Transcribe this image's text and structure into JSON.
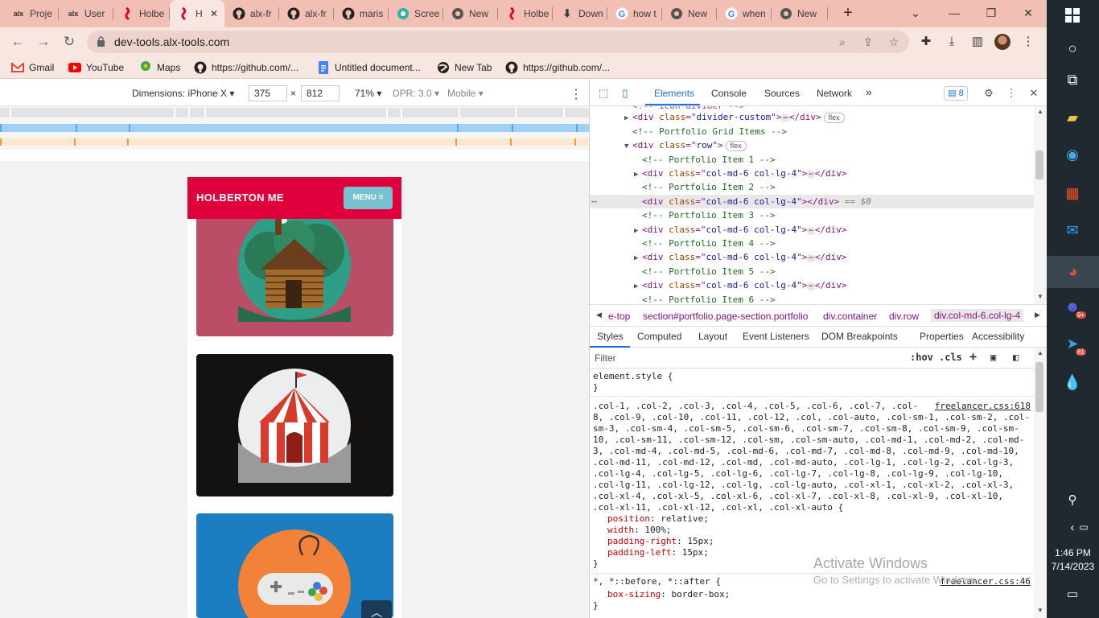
{
  "browser": {
    "tabs": [
      {
        "title": "Proje",
        "icon": "alx-logo-icon",
        "icon_text": "alx"
      },
      {
        "title": "User",
        "icon": "alx-logo-icon",
        "icon_text": "alx"
      },
      {
        "title": "Holbe",
        "icon": "holberton-logo-icon",
        "icon_text": ""
      },
      {
        "title": "H",
        "icon": "holberton-logo-icon",
        "icon_text": "",
        "active": true
      },
      {
        "title": "alx-fr",
        "icon": "github-icon",
        "icon_text": ""
      },
      {
        "title": "alx-fr",
        "icon": "github-icon",
        "icon_text": ""
      },
      {
        "title": "maris",
        "icon": "github-icon",
        "icon_text": ""
      },
      {
        "title": "Scree",
        "icon": "screen-app-icon",
        "icon_text": ""
      },
      {
        "title": "New",
        "icon": "chrome-icon",
        "icon_text": ""
      },
      {
        "title": "Holbe",
        "icon": "holberton-logo-icon",
        "icon_text": ""
      },
      {
        "title": "Down",
        "icon": "download-icon",
        "icon_text": "⬇"
      },
      {
        "title": "how t",
        "icon": "google-icon",
        "icon_text": "G"
      },
      {
        "title": "New",
        "icon": "chrome-icon",
        "icon_text": ""
      },
      {
        "title": "when",
        "icon": "google-icon",
        "icon_text": "G"
      },
      {
        "title": "New",
        "icon": "chrome-icon",
        "icon_text": ""
      }
    ],
    "new_tab_label": "+",
    "url": "dev-tools.alx-tools.com",
    "bookmarks": [
      {
        "label": "Gmail",
        "icon": "gmail-icon"
      },
      {
        "label": "YouTube",
        "icon": "youtube-icon"
      },
      {
        "label": "Maps",
        "icon": "maps-icon"
      },
      {
        "label": "https://github.com/...",
        "icon": "github-icon"
      },
      {
        "label": "Untitled document...",
        "icon": "docs-icon"
      },
      {
        "label": "New Tab",
        "icon": "globe-icon"
      },
      {
        "label": "https://github.com/...",
        "icon": "github-icon"
      }
    ]
  },
  "device_toolbar": {
    "dimensions_label": "Dimensions: iPhone X",
    "width_value": "375",
    "times": "×",
    "height_value": "812",
    "zoom": "71%",
    "dpr": "DPR: 3.0",
    "mode": "Mobile"
  },
  "page": {
    "brand": "HOLBERTON ME",
    "menu_label": "MENU",
    "cards": [
      {
        "name": "cabin",
        "bg": "#b94e66"
      },
      {
        "name": "circus-tent",
        "bg": "#141111"
      },
      {
        "name": "game-controller",
        "bg": "#1b7ec0"
      }
    ],
    "accent": "#e0003c"
  },
  "devtools": {
    "tabs": [
      "Elements",
      "Console",
      "Sources",
      "Network"
    ],
    "more": "»",
    "issues_count": "8",
    "dom_lines": [
      {
        "indent": 0,
        "arrow": "",
        "parts": [
          [
            "tg",
            "<!-- icon divider -->"
          ]
        ],
        "truncated_top": true
      },
      {
        "indent": 0,
        "arrow": "▶",
        "parts": [
          [
            "tg",
            "<div "
          ],
          [
            "at",
            "class"
          ],
          [
            "tg",
            "=\""
          ],
          [
            "av",
            "divider-custom"
          ],
          [
            "tg",
            "\">"
          ],
          [
            "dots",
            "⋯"
          ],
          [
            "tg",
            "</div>"
          ],
          [
            "pill",
            "flex"
          ]
        ]
      },
      {
        "indent": 0,
        "arrow": "",
        "parts": [
          [
            "cm",
            "<!-- Portfolio Grid Items -->"
          ]
        ]
      },
      {
        "indent": 0,
        "arrow": "▼",
        "parts": [
          [
            "tg",
            "<div "
          ],
          [
            "at",
            "class"
          ],
          [
            "tg",
            "=\""
          ],
          [
            "av",
            "row"
          ],
          [
            "tg",
            "\">"
          ],
          [
            "pill",
            "flex"
          ]
        ]
      },
      {
        "indent": 1,
        "arrow": "",
        "parts": [
          [
            "cm",
            "<!-- Portfolio Item 1 -->"
          ]
        ]
      },
      {
        "indent": 1,
        "arrow": "▶",
        "parts": [
          [
            "tg",
            "<div "
          ],
          [
            "at",
            "class"
          ],
          [
            "tg",
            "=\""
          ],
          [
            "av",
            "col-md-6 col-lg-4"
          ],
          [
            "tg",
            "\">"
          ],
          [
            "dots",
            "⋯"
          ],
          [
            "tg",
            "</div>"
          ]
        ]
      },
      {
        "indent": 1,
        "arrow": "",
        "parts": [
          [
            "cm",
            "<!-- Portfolio Item 2 -->"
          ]
        ]
      },
      {
        "indent": 1,
        "arrow": "",
        "selected": true,
        "parts": [
          [
            "tg",
            "<div "
          ],
          [
            "at",
            "class"
          ],
          [
            "tg",
            "=\""
          ],
          [
            "av",
            "col-md-6 col-lg-4"
          ],
          [
            "tg",
            "\"></div>"
          ],
          [
            "eq",
            " == $0"
          ]
        ]
      },
      {
        "indent": 1,
        "arrow": "",
        "parts": [
          [
            "cm",
            "<!-- Portfolio Item 3 -->"
          ]
        ]
      },
      {
        "indent": 1,
        "arrow": "▶",
        "parts": [
          [
            "tg",
            "<div "
          ],
          [
            "at",
            "class"
          ],
          [
            "tg",
            "=\""
          ],
          [
            "av",
            "col-md-6 col-lg-4"
          ],
          [
            "tg",
            "\">"
          ],
          [
            "dots",
            "⋯"
          ],
          [
            "tg",
            "</div>"
          ]
        ]
      },
      {
        "indent": 1,
        "arrow": "",
        "parts": [
          [
            "cm",
            "<!-- Portfolio Item 4 -->"
          ]
        ]
      },
      {
        "indent": 1,
        "arrow": "▶",
        "parts": [
          [
            "tg",
            "<div "
          ],
          [
            "at",
            "class"
          ],
          [
            "tg",
            "=\""
          ],
          [
            "av",
            "col-md-6 col-lg-4"
          ],
          [
            "tg",
            "\">"
          ],
          [
            "dots",
            "⋯"
          ],
          [
            "tg",
            "</div>"
          ]
        ]
      },
      {
        "indent": 1,
        "arrow": "",
        "parts": [
          [
            "cm",
            "<!-- Portfolio Item 5 -->"
          ]
        ]
      },
      {
        "indent": 1,
        "arrow": "▶",
        "parts": [
          [
            "tg",
            "<div "
          ],
          [
            "at",
            "class"
          ],
          [
            "tg",
            "=\""
          ],
          [
            "av",
            "col-md-6 col-lg-4"
          ],
          [
            "tg",
            "\">"
          ],
          [
            "dots",
            "⋯"
          ],
          [
            "tg",
            "</div>"
          ]
        ]
      },
      {
        "indent": 1,
        "arrow": "",
        "parts": [
          [
            "cm",
            "<!-- Portfolio Item 6 -->"
          ]
        ]
      }
    ],
    "breadcrumbs": [
      "e-top",
      "section#portfolio.page-section.portfolio",
      "div.container",
      "div.row",
      "div.col-md-6.col-lg-4"
    ],
    "styles_tabs": [
      "Styles",
      "Computed",
      "Layout",
      "Event Listeners",
      "DOM Breakpoints",
      "Properties",
      "Accessibility"
    ],
    "filter_placeholder": "Filter",
    "hov": ":hov",
    "cls": ".cls",
    "element_style": "element.style {",
    "close_brace": "}",
    "rule1_source": "freelancer.css:618",
    "rule1_selector_lines": [
      ".col-1, .col-2, .col-3, .col-4, .col-5, .col-6, .col-7, .col-",
      "8, .col-9, .col-10, .col-11, .col-12, .col, .col-auto, .col-sm-1, .col-sm-2, .col-",
      "sm-3, .col-sm-4, .col-sm-5, .col-sm-6, .col-sm-7, .col-sm-8, .col-sm-9, .col-sm-",
      "10, .col-sm-11, .col-sm-12, .col-sm, .col-sm-auto, .col-md-1, .col-md-2, .col-md-",
      "3, .col-md-4, .col-md-5, .col-md-6, .col-md-7, .col-md-8, .col-md-9, .col-md-10,",
      ".col-md-11, .col-md-12, .col-md, .col-md-auto, .col-lg-1, .col-lg-2, .col-lg-3,",
      ".col-lg-4, .col-lg-5, .col-lg-6, .col-lg-7, .col-lg-8, .col-lg-9, .col-lg-10,",
      ".col-lg-11, .col-lg-12, .col-lg, .col-lg-auto, .col-xl-1, .col-xl-2, .col-xl-3,",
      ".col-xl-4, .col-xl-5, .col-xl-6, .col-xl-7, .col-xl-8, .col-xl-9, .col-xl-10,",
      ".col-xl-11, .col-xl-12, .col-xl, .col-xl-auto {"
    ],
    "rule1_props": [
      [
        "position",
        "relative;"
      ],
      [
        "width",
        "100%;"
      ],
      [
        "padding-right",
        "15px;"
      ],
      [
        "padding-left",
        "15px;"
      ]
    ],
    "rule2_selector": "*, *::before, *::after {",
    "rule2_source": "freelancer.css:46",
    "rule2_props": [
      [
        "box-sizing",
        "border-box;"
      ]
    ],
    "watermark_title": "Activate Windows",
    "watermark_sub": "Go to Settings to activate Windows."
  },
  "taskbar": {
    "time": "1:46 PM",
    "date": "7/14/2023",
    "discord_badge": "9+",
    "telegram_badge": "81"
  }
}
